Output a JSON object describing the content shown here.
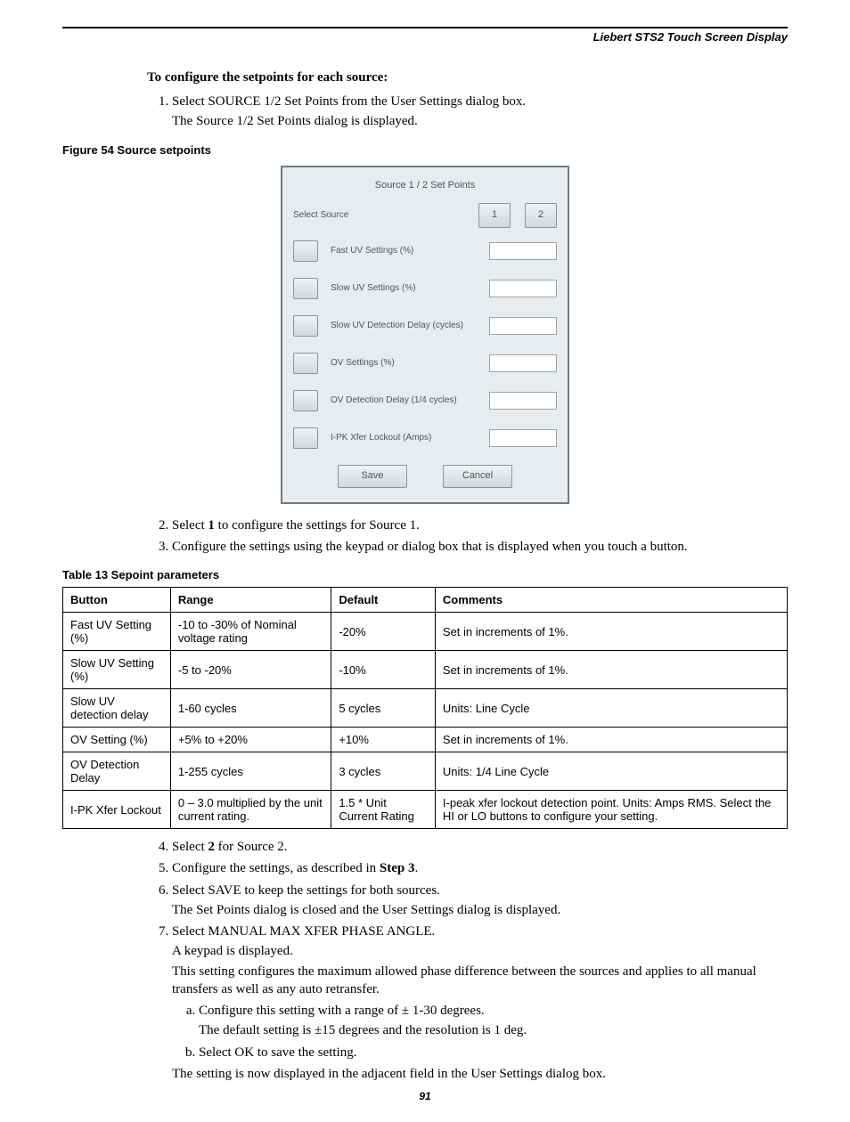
{
  "header": "Liebert STS2 Touch Screen Display",
  "intro_bold": "To configure the setpoints for each source:",
  "step1_a": "Select SOURCE 1/2 Set Points from the User Settings dialog box.",
  "step1_b": "The Source 1/2 Set Points dialog is displayed.",
  "figure_caption": "Figure 54  Source setpoints",
  "dialog": {
    "title": "Source 1 / 2 Set Points",
    "select_source": "Select Source",
    "src1": "1",
    "src2": "2",
    "rows": [
      "Fast UV Settings (%)",
      "Slow UV Settings (%)",
      "Slow UV Detection Delay (cycles)",
      "OV Settings (%)",
      "OV Detection Delay (1/4 cycles)",
      "I-PK Xfer Lockout (Amps)"
    ],
    "save": "Save",
    "cancel": "Cancel"
  },
  "step2": "Select 1 to configure the settings for Source 1.",
  "step2_bold": "1",
  "step3": "Configure the settings using the keypad or dialog box that is displayed when you touch a button.",
  "table_caption": "Table 13     Sepoint parameters",
  "table": {
    "headers": [
      "Button",
      "Range",
      "Default",
      "Comments"
    ],
    "rows": [
      [
        "Fast UV Setting (%)",
        "-10 to -30% of Nominal voltage rating",
        "-20%",
        "Set in increments of 1%."
      ],
      [
        "Slow UV Setting (%)",
        "-5 to -20%",
        "-10%",
        "Set in increments of 1%."
      ],
      [
        "Slow UV detection delay",
        "1-60 cycles",
        "5 cycles",
        "Units: Line Cycle"
      ],
      [
        "OV Setting (%)",
        "+5% to +20%",
        "+10%",
        "Set in increments of 1%."
      ],
      [
        "OV Detection Delay",
        "1-255 cycles",
        "3 cycles",
        "Units: 1/4 Line Cycle"
      ],
      [
        "I-PK Xfer Lockout",
        "0 – 3.0 multiplied by the unit current rating.",
        "1.5 * Unit Current Rating",
        "I-peak xfer lockout detection point. Units: Amps RMS. Select the HI or LO buttons to configure your setting."
      ]
    ]
  },
  "step4_pre": "Select ",
  "step4_bold": "2",
  "step4_post": " for Source 2.",
  "step5_pre": "Configure the settings, as described in ",
  "step5_bold": "Step 3",
  "step5_post": ".",
  "step6_a": "Select SAVE to keep the settings for both sources.",
  "step6_b": "The Set Points dialog is closed and the User Settings dialog is displayed.",
  "step7_a": "Select MANUAL MAX XFER PHASE ANGLE.",
  "step7_b": "A keypad is displayed.",
  "step7_c": "This setting configures the maximum allowed phase difference between the sources and applies to all manual transfers as well as any auto retransfer.",
  "step7_sub_a1": "Configure this setting with a range of ± 1-30 degrees.",
  "step7_sub_a2": "The default setting is ±15 degrees and the resolution is 1 deg.",
  "step7_sub_b": "Select OK to save the setting.",
  "step7_d": "The setting is now displayed in the adjacent field in the User Settings dialog box.",
  "page_number": "91"
}
